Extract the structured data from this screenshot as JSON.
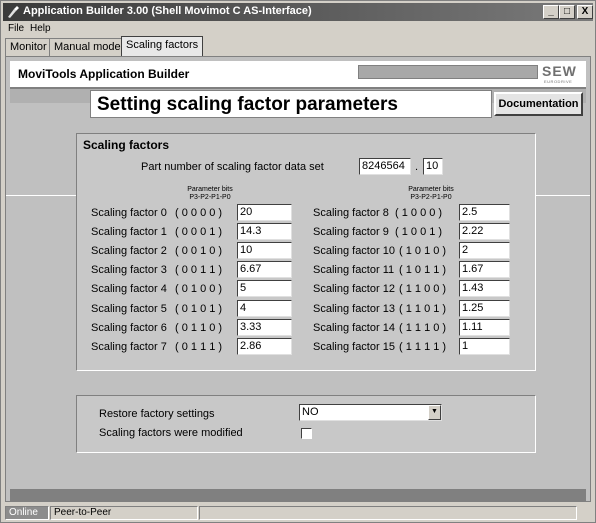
{
  "window": {
    "title": "Application Builder  3.00 (Shell Movimot C AS-Interface)",
    "buttons": {
      "minimize": "_",
      "maximize": "□",
      "close": "X"
    }
  },
  "menu": [
    "File",
    "Help"
  ],
  "tabs": [
    "Monitor",
    "Manual mode",
    "Scaling factors"
  ],
  "header": {
    "brand": "MoviTools Application Builder",
    "logo": "SEW",
    "logo_sub": "EURODRIVE"
  },
  "page": {
    "title": "Setting scaling factor parameters",
    "documentation_button": "Documentation"
  },
  "scaling": {
    "section_title": "Scaling factors",
    "part_number_label": "Part number of scaling factor data set",
    "part_number": "8246564",
    "part_number_sep": ".",
    "part_suffix": "10",
    "bits_header_line1": "Parameter bits",
    "bits_header_line2": "P3-P2-P1-P0",
    "left": [
      {
        "label": "Scaling factor 0",
        "bits": "( 0 0 0 0 )",
        "value": "20"
      },
      {
        "label": "Scaling factor 1",
        "bits": "( 0 0 0 1 )",
        "value": "14.3"
      },
      {
        "label": "Scaling factor 2",
        "bits": "( 0 0 1 0 )",
        "value": "10"
      },
      {
        "label": "Scaling factor 3",
        "bits": "( 0 0 1 1 )",
        "value": "6.67"
      },
      {
        "label": "Scaling factor 4",
        "bits": "( 0 1 0 0 )",
        "value": "5"
      },
      {
        "label": "Scaling factor 5",
        "bits": "( 0 1 0 1 )",
        "value": "4"
      },
      {
        "label": "Scaling factor 6",
        "bits": "( 0 1 1 0 )",
        "value": "3.33"
      },
      {
        "label": "Scaling factor 7",
        "bits": "( 0 1 1 1 )",
        "value": "2.86"
      }
    ],
    "right": [
      {
        "label": "Scaling factor 8",
        "bits": "( 1 0 0 0 )",
        "value": "2.5"
      },
      {
        "label": "Scaling factor 9",
        "bits": "( 1 0 0 1 )",
        "value": "2.22"
      },
      {
        "label": "Scaling factor 10",
        "bits": "( 1 0 1 0 )",
        "value": "2"
      },
      {
        "label": "Scaling factor 11",
        "bits": "( 1 0 1 1 )",
        "value": "1.67"
      },
      {
        "label": "Scaling factor 12",
        "bits": "( 1 1 0 0 )",
        "value": "1.43"
      },
      {
        "label": "Scaling factor 13",
        "bits": "( 1 1 0 1 )",
        "value": "1.25"
      },
      {
        "label": "Scaling factor 14",
        "bits": "( 1 1 1 0 )",
        "value": "1.11"
      },
      {
        "label": "Scaling factor 15",
        "bits": "( 1 1 1 1 )",
        "value": "1"
      }
    ]
  },
  "restore": {
    "restore_label": "Restore factory settings",
    "restore_value": "NO",
    "modified_label": "Scaling factors were modified",
    "modified_checked": false
  },
  "status": {
    "connection": "Online",
    "mode": "Peer-to-Peer"
  }
}
